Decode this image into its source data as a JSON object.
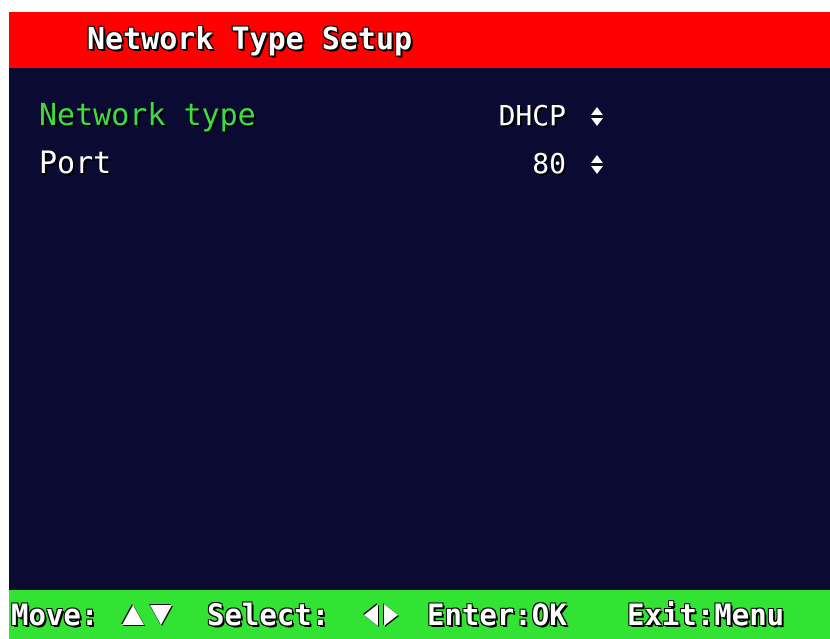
{
  "title_bar": {
    "title": "Network Type Setup",
    "color": "#ff0000"
  },
  "menu": {
    "items": [
      {
        "label": "Network type",
        "value": "DHCP",
        "selected": true,
        "icon": "up-down-arrows-icon"
      },
      {
        "label": "Port",
        "value": "80",
        "selected": false,
        "icon": "up-down-arrows-icon"
      }
    ],
    "selected_color": "#3fdc3f",
    "background_color": "#0b0a33"
  },
  "help_bar": {
    "move_label": "Move:",
    "select_label": "Select:",
    "enter_label": "Enter:OK",
    "exit_label": "Exit:Menu",
    "color": "#33e333",
    "icons": [
      "up-triangle-icon",
      "down-triangle-icon",
      "left-triangle-icon",
      "right-triangle-icon"
    ]
  }
}
